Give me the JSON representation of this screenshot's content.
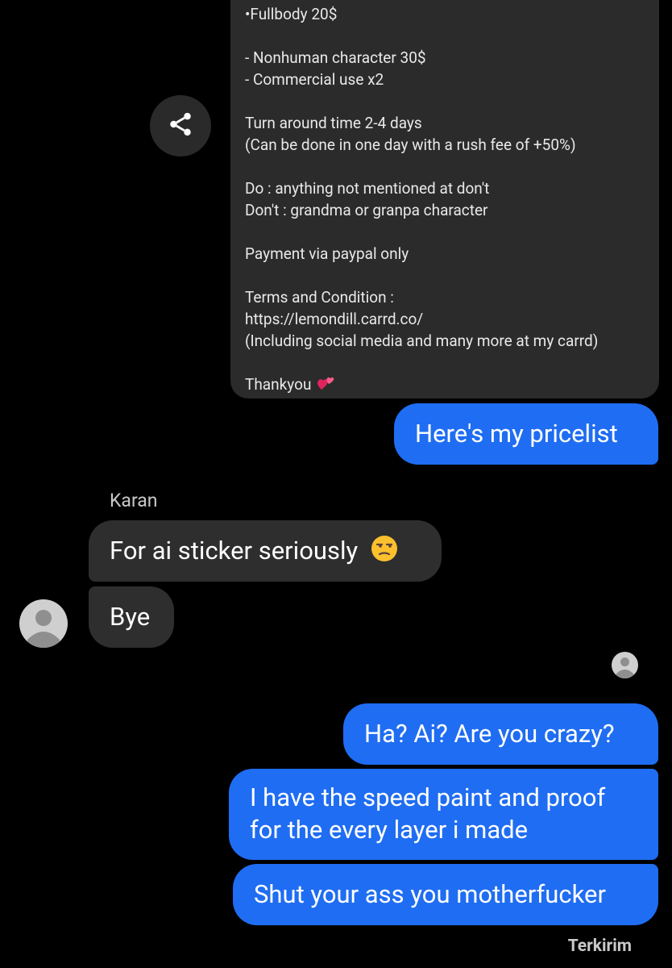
{
  "pricelist_card": {
    "lines": [
      "•Fullbody 20$",
      "- Nonhuman character 30$",
      "- Commercial use x2",
      "Turn around time 2-4 days",
      "(Can be done in one day with a rush fee of +50%)",
      "Do : anything not mentioned at don't",
      "Don't : grandma or granpa character",
      "Payment via paypal only",
      "Terms and Condition :",
      "https://lemondill.carrd.co/",
      "(Including social media and many more at my carrd)",
      "Thankyou"
    ],
    "heart_emoji": "💕"
  },
  "share_button": {
    "icon": "share-icon"
  },
  "messages": {
    "sent_pricelist": "Here's my pricelist",
    "sender_name": "Karan",
    "recv_1": "For ai sticker seriously",
    "recv_1_emoji": "unamused-face",
    "recv_2": "Bye",
    "sent_1": "Ha? Ai? Are you crazy?",
    "sent_2_line1": "I have the speed paint and proof",
    "sent_2_line2": "for the every layer i made",
    "sent_3": "Shut your ass you motherfucker"
  },
  "status": "Terkirim",
  "colors": {
    "background": "#000000",
    "outgoing_bubble": "#1f6df2",
    "incoming_bubble": "#2e2e2e",
    "card": "#2b2b2b",
    "avatar": "#cfcfcf"
  }
}
